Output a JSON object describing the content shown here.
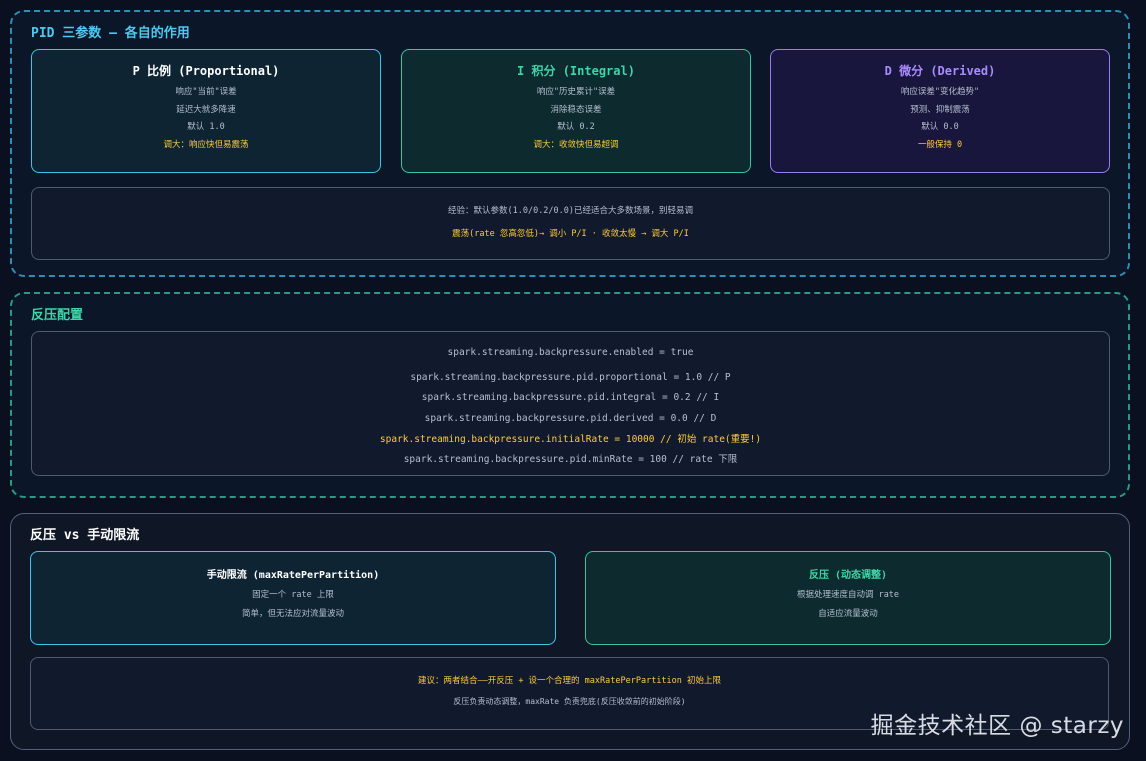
{
  "pid_section": {
    "title": "PID 三参数 — 各自的作用",
    "cards": [
      {
        "title": "P 比例 (Proportional)",
        "lines": [
          "响应\"当前\"误差",
          "延迟大就多降速",
          "默认 1.0"
        ],
        "highlight": "调大：响应快但易震荡"
      },
      {
        "title": "I 积分 (Integral)",
        "lines": [
          "响应\"历史累计\"误差",
          "消除稳态误差",
          "默认 0.2"
        ],
        "highlight": "调大：收敛快但易超调"
      },
      {
        "title": "D 微分 (Derived)",
        "lines": [
          "响应误差\"变化趋势\"",
          "预测、抑制震荡",
          "默认 0.0"
        ],
        "highlight": "一般保持 0"
      }
    ],
    "note": {
      "line1": "经验：默认参数(1.0/0.2/0.0)已经适合大多数场景，别轻易调",
      "line2": "震荡(rate 忽高忽低)→ 调小 P/I · 收敛太慢 → 调大 P/I"
    }
  },
  "config_section": {
    "title": "反压配置",
    "lines": [
      "spark.streaming.backpressure.enabled = true",
      "spark.streaming.backpressure.pid.proportional = 1.0 // P",
      "spark.streaming.backpressure.pid.integral = 0.2 // I",
      "spark.streaming.backpressure.pid.derived = 0.0 // D",
      "spark.streaming.backpressure.initialRate = 10000 // 初始 rate(重要!)",
      "spark.streaming.backpressure.pid.minRate = 100 // rate 下限"
    ]
  },
  "compare_section": {
    "title": "反压 vs 手动限流",
    "manual": {
      "title": "手动限流 (maxRatePerPartition)",
      "lines": [
        "固定一个 rate 上限",
        "简单，但无法应对流量波动"
      ]
    },
    "backpressure": {
      "title": "反压 (动态调整)",
      "lines": [
        "根据处理速度自动调 rate",
        "自适应流量波动"
      ]
    },
    "note": {
      "line1": "建议：两者结合——开反压 + 设一个合理的 maxRatePerPartition 初始上限",
      "line2": "反压负责动态调整，maxRate 负责兜底(反压收敛前的初始阶段)"
    }
  },
  "watermark": "掘金技术社区 @ starzy"
}
